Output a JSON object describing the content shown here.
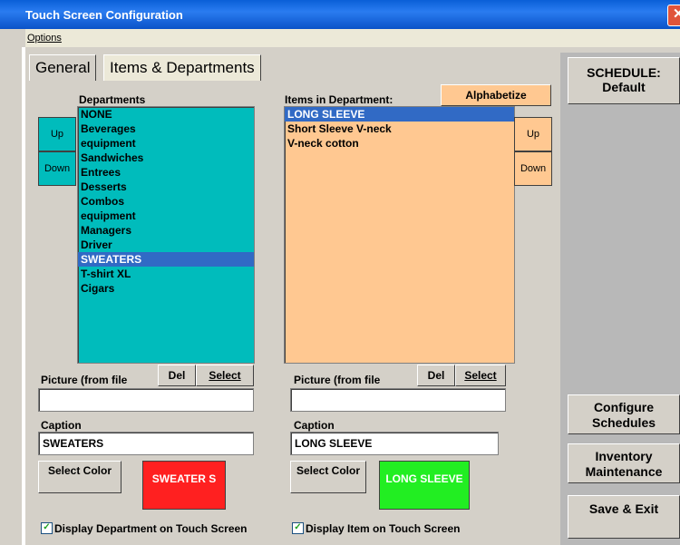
{
  "window": {
    "title": "Touch Screen Configuration",
    "close_glyph": "✕"
  },
  "menu": {
    "options": "Options"
  },
  "tabs": [
    {
      "label": "General"
    },
    {
      "label": "Items & Departments"
    }
  ],
  "departments": {
    "header": "Departments",
    "items": [
      "NONE",
      "Beverages",
      "equipment",
      "Sandwiches",
      "Entrees",
      "Desserts",
      "Combos",
      "equipment",
      "Managers",
      "Driver",
      "SWEATERS",
      "T-shirt XL",
      "Cigars"
    ],
    "selected_index": 10,
    "up": "Up",
    "down": "Down",
    "picture_label": "Picture (from file",
    "del": "Del",
    "select": "Select",
    "picture_value": "",
    "caption_label": "Caption",
    "caption_value": "SWEATERS",
    "select_color": "Select Color",
    "preview_text": "SWEATER S",
    "preview_color": "#ff2020",
    "display_check": "Display Department on Touch Screen"
  },
  "items": {
    "header": "Items in Department:",
    "alphabetize": "Alphabetize",
    "list": [
      "LONG SLEEVE",
      "Short Sleeve V-neck",
      "V-neck cotton"
    ],
    "selected_index": 0,
    "up": "Up",
    "down": "Down",
    "picture_label": "Picture (from file",
    "del": "Del",
    "select": "Select",
    "picture_value": "",
    "caption_label": "Caption",
    "caption_value": "LONG SLEEVE",
    "select_color": "Select Color",
    "preview_text": "LONG SLEEVE",
    "preview_color": "#22ee22",
    "display_check": "Display Item on Touch Screen"
  },
  "right": {
    "schedule": "SCHEDULE: Default",
    "configure": "Configure Schedules",
    "inventory": "Inventory Maintenance",
    "save": "Save & Exit"
  },
  "colors": {
    "dept_list": "#00bcbc",
    "item_list": "#ffc891",
    "selection": "#316ac5"
  }
}
